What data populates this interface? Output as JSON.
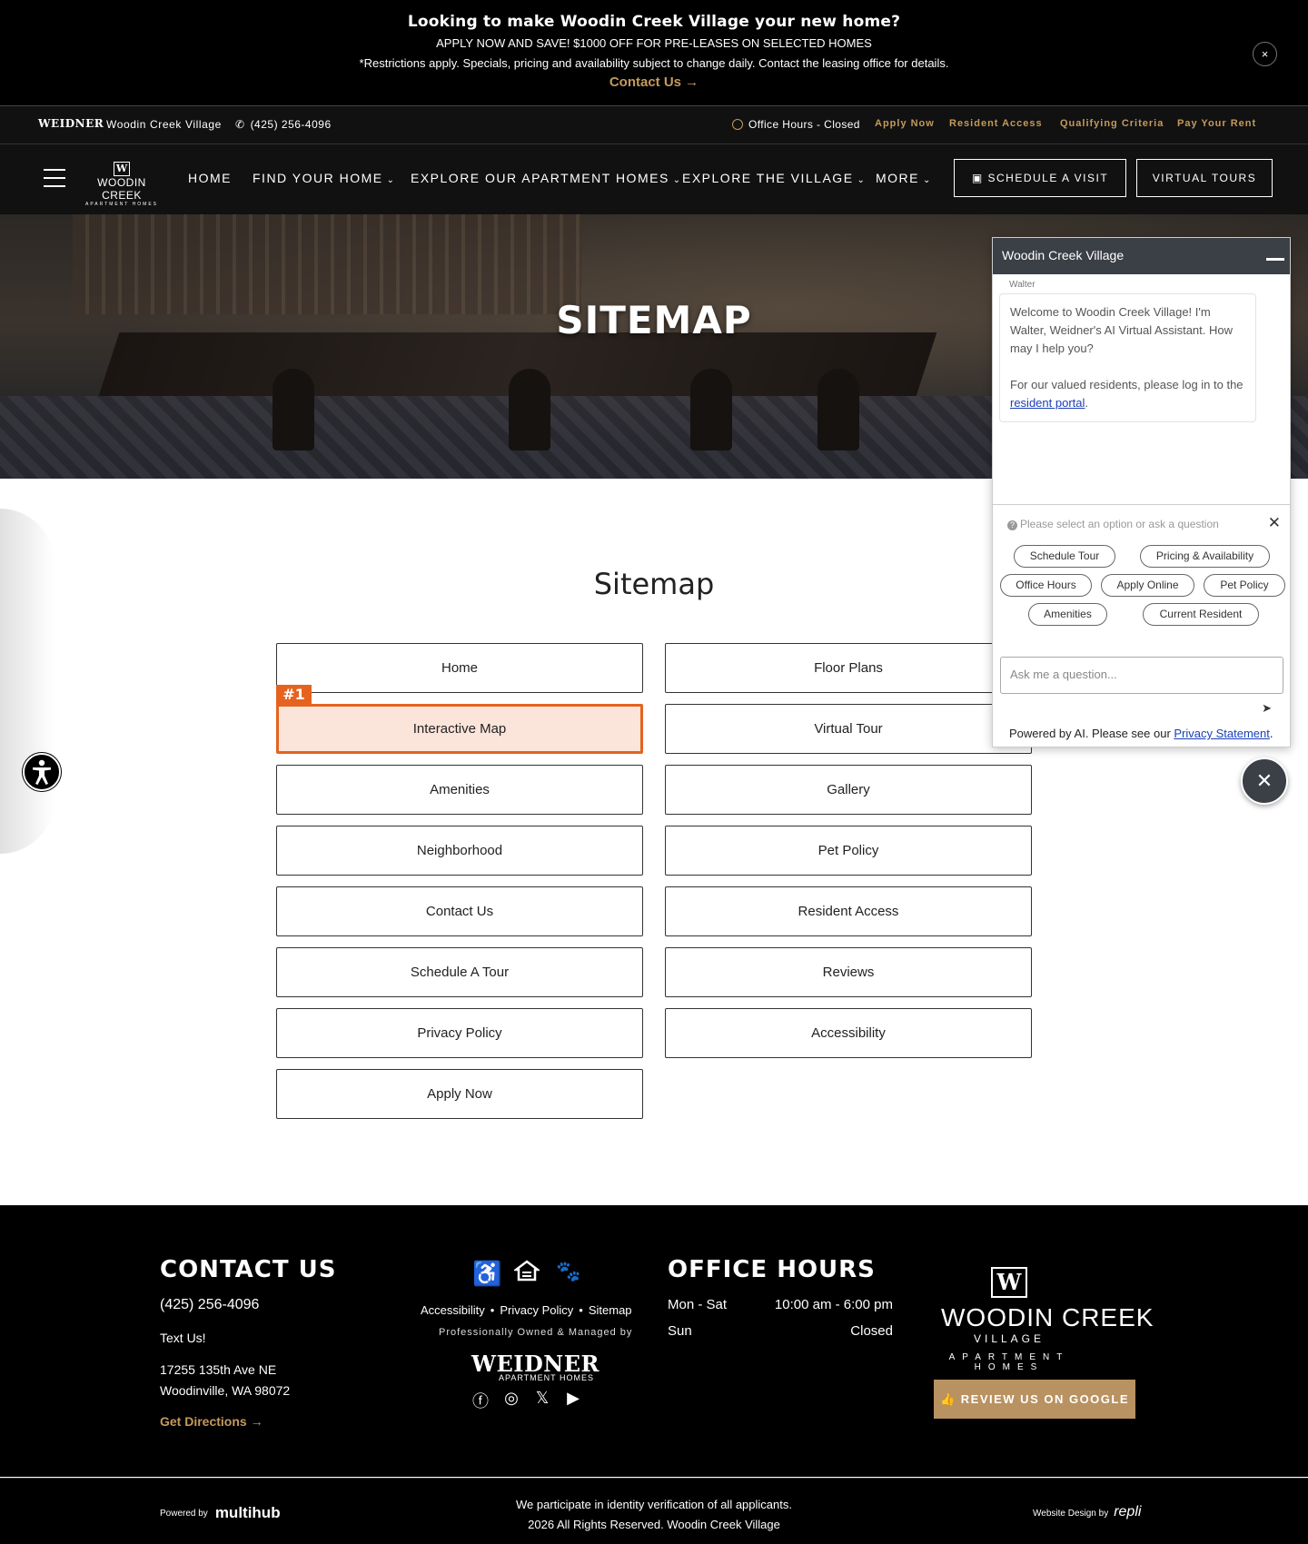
{
  "promo": {
    "headline": "Looking to make Woodin Creek Village your new home?",
    "subheadline": "APPLY NOW AND SAVE! $1000 OFF FOR PRE-LEASES ON SELECTED HOMES",
    "fine_print": "*Restrictions apply. Specials, pricing and availability subject to change daily. Contact the leasing office for details.",
    "contact_label": "Contact Us →",
    "close_icon": "×"
  },
  "utility": {
    "brand_mini": "WEIDNER",
    "community_name": "Woodin Creek Village",
    "phone": "(425) 256-4096",
    "office_hours": "Office Hours - Closed",
    "links": [
      "Apply Now",
      "Resident Access",
      "Qualifying Criteria",
      "Pay Your Rent"
    ]
  },
  "nav": {
    "logo": {
      "mono": "W",
      "name": "WOODIN CREEK",
      "tag": "APARTMENT HOMES"
    },
    "items": [
      {
        "label": "HOME",
        "chevron": ""
      },
      {
        "label": "FIND YOUR HOME",
        "chevron": "⌄"
      },
      {
        "label": "EXPLORE OUR APARTMENT HOMES",
        "chevron": "⌄"
      },
      {
        "label": "EXPLORE THE VILLAGE",
        "chevron": "⌄"
      },
      {
        "label": "MORE",
        "chevron": "⌄"
      }
    ],
    "schedule_label": "SCHEDULE A VISIT",
    "virtual_label": "VIRTUAL TOURS"
  },
  "hero": {
    "title": "SITEMAP"
  },
  "sitemap": {
    "title": "Sitemap",
    "left": [
      "Home",
      "Interactive Map",
      "Amenities",
      "Neighborhood",
      "Contact Us",
      "Schedule A Tour",
      "Privacy Policy",
      "Apply Now"
    ],
    "right": [
      "Floor Plans",
      "Virtual Tour",
      "Gallery",
      "Pet Policy",
      "Resident Access",
      "Reviews",
      "Accessibility"
    ],
    "badge": "#1"
  },
  "chat": {
    "title": "Woodin Creek Village",
    "sender": "Walter",
    "welcome": "Welcome to Woodin Creek Village! I'm Walter, Weidner's AI Virtual Assistant. How may I help you?",
    "resident_prefix": "For our valued residents, please log in to the ",
    "resident_link": "resident portal",
    "resident_suffix": ".",
    "prompt": "Please select an option or ask a question",
    "chips": [
      "Schedule Tour",
      "Pricing & Availability",
      "Office Hours",
      "Apply Online",
      "Pet Policy",
      "Amenities",
      "Current Resident"
    ],
    "input_placeholder": "Ask me a question...",
    "powered_prefix": "Powered by AI. Please see our ",
    "powered_link": "Privacy Statement",
    "powered_suffix": "."
  },
  "footer": {
    "contact_heading": "CONTACT US",
    "phone": "(425) 256-4096",
    "text_us": "Text Us!",
    "address_line1": "17255 135th Ave NE",
    "address_line2": "Woodinville, WA 98072",
    "directions": "Get Directions →",
    "links": [
      "Accessibility",
      "Privacy Policy",
      "Sitemap"
    ],
    "managed_by": "Professionally Owned & Managed by",
    "weidner": "WEIDNER",
    "weidner_sub": "APARTMENT HOMES",
    "hours_heading": "OFFICE HOURS",
    "hours": [
      {
        "day": "Mon - Sat",
        "time": "10:00 am - 6:00 pm"
      },
      {
        "day": "Sun",
        "time": "Closed"
      }
    ],
    "logo": {
      "mono": "W",
      "name": "WOODIN CREEK",
      "village": "VILLAGE",
      "apt": "APARTMENT HOMES"
    },
    "review_label": "REVIEW US ON GOOGLE"
  },
  "bottom": {
    "powered_by": "Powered by",
    "multihub": "multihub",
    "identity": "We participate in identity verification of all applicants.",
    "copyright": "2026 All Rights Reserved. Woodin Creek Village",
    "design_by": "Website Design by",
    "repli": "repli"
  },
  "colors": {
    "accent_gold": "#c49a5b",
    "highlight_orange": "#e5631f",
    "chat_header": "#3b3f46"
  }
}
